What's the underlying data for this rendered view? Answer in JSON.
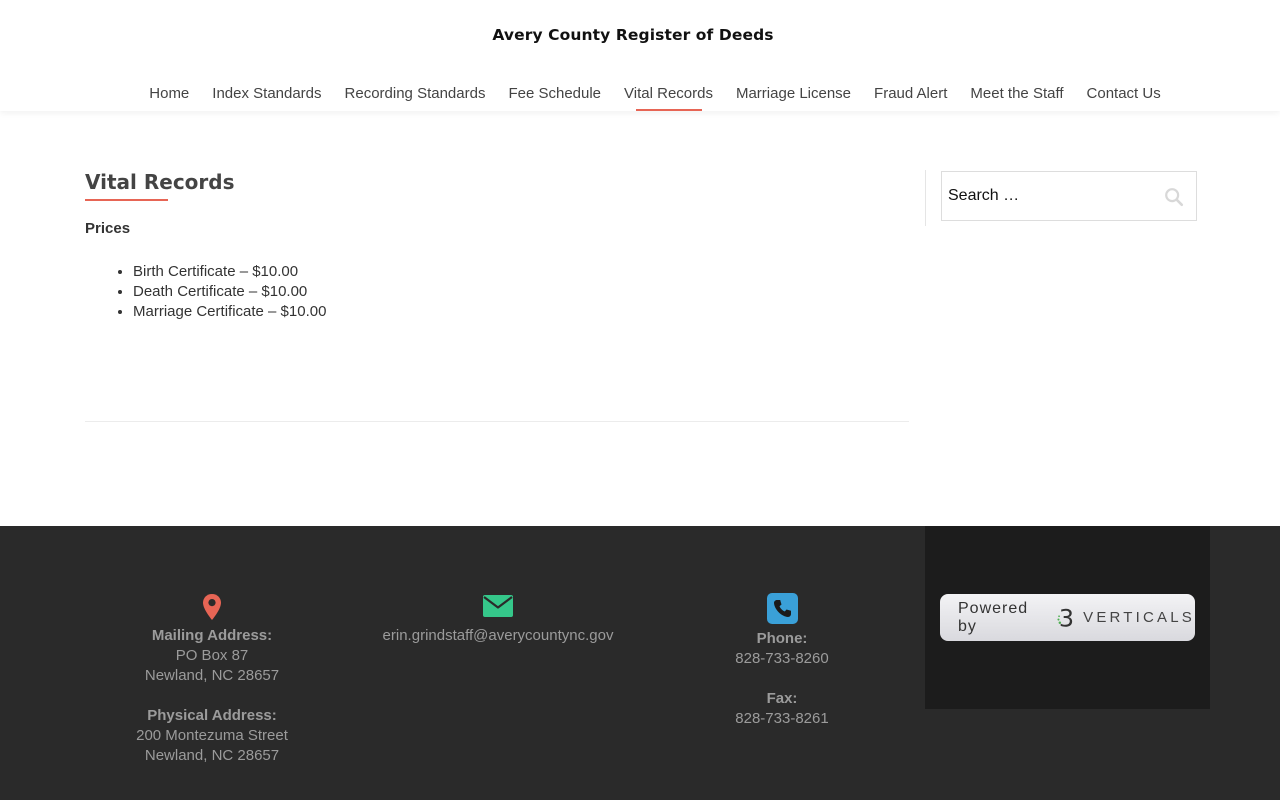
{
  "header": {
    "site_title": "Avery County Register of Deeds",
    "nav": [
      {
        "label": "Home",
        "active": false
      },
      {
        "label": "Index Standards",
        "active": false
      },
      {
        "label": "Recording Standards",
        "active": false
      },
      {
        "label": "Fee Schedule",
        "active": false
      },
      {
        "label": "Vital Records",
        "active": true
      },
      {
        "label": "Marriage License",
        "active": false
      },
      {
        "label": "Fraud Alert",
        "active": false
      },
      {
        "label": "Meet the Staff",
        "active": false
      },
      {
        "label": "Contact Us",
        "active": false
      }
    ]
  },
  "main": {
    "page_title": "Vital Records",
    "section_heading": "Prices",
    "prices": [
      "Birth Certificate – $10.00",
      "Death Certificate – $10.00",
      "Marriage Certificate – $10.00"
    ]
  },
  "sidebar": {
    "search": {
      "placeholder": "Search …",
      "icon": "search-icon"
    }
  },
  "footer": {
    "address": {
      "icon": "map-pin-icon",
      "mailing_label": "Mailing Address:",
      "mailing_line1": "PO Box 87",
      "mailing_line2": "Newland, NC 28657",
      "physical_label": "Physical Address:",
      "physical_line1": "200 Montezuma Street",
      "physical_line2": "Newland, NC 28657"
    },
    "email": {
      "icon": "envelope-icon",
      "address": "erin.grindstaff@averycountync.gov"
    },
    "phone": {
      "icon": "phone-icon",
      "phone_label": "Phone:",
      "phone_number": "828-733-8260",
      "fax_label": "Fax:",
      "fax_number": "828-733-8261"
    },
    "powered_by": {
      "prefix": "Powered by",
      "brand": "VERTICALS",
      "brand_mark": "3"
    }
  },
  "colors": {
    "accent": "#e76555",
    "email_icon": "#35c78a",
    "phone_icon": "#3aa0d8",
    "footer_bg": "#2a2a2a",
    "footer_widget_bg": "#1c1c1c"
  }
}
